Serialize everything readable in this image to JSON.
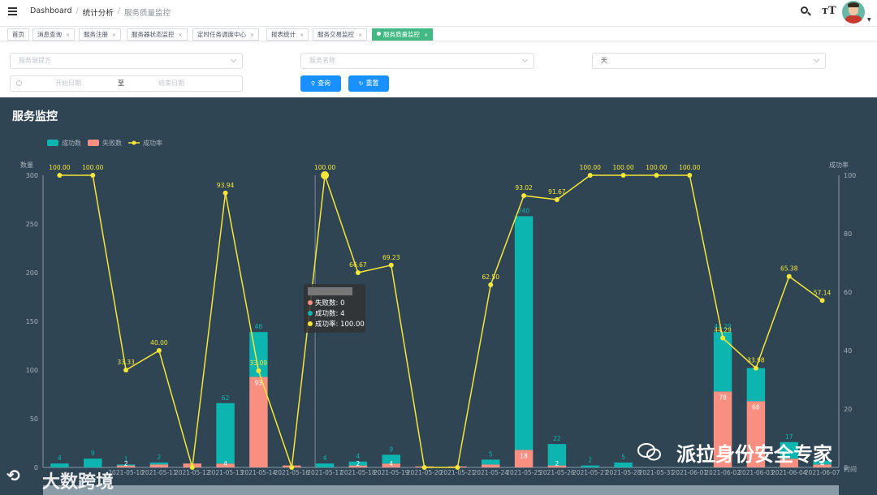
{
  "breadcrumb": [
    "Dashboard",
    "统计分析",
    "服务质量监控"
  ],
  "tabs": [
    {
      "label": "首页",
      "closable": false,
      "active": false
    },
    {
      "label": "消息查询",
      "closable": true,
      "active": false
    },
    {
      "label": "服务注册",
      "closable": true,
      "active": false
    },
    {
      "label": "服务器状态监控",
      "closable": true,
      "active": false
    },
    {
      "label": "定时任务调度中心",
      "closable": true,
      "active": false
    },
    {
      "label": "报表统计",
      "closable": true,
      "active": false
    },
    {
      "label": "服务交易监控",
      "closable": true,
      "active": false
    },
    {
      "label": "服务质量监控",
      "closable": true,
      "active": true
    }
  ],
  "filters": {
    "provider_placeholder": "服务端提方",
    "service_placeholder": "服务名称",
    "granularity_value": "天",
    "start_placeholder": "开始日期",
    "range_sep": "至",
    "end_placeholder": "结束日期",
    "query_label": "查询",
    "reset_label": "重置"
  },
  "panel": {
    "title": "服务监控"
  },
  "tooltip": {
    "failed": "失败数: 0",
    "success": "成功数: 4",
    "rate": "成功率: 100.00"
  },
  "watermarks": {
    "wechat": "派拉身份安全专家",
    "brand": "大数跨境"
  },
  "colors": {
    "panel_bg": "#2f4554",
    "success": "#0cb5b0",
    "failed": "#f88f80",
    "rate": "#f5e637"
  },
  "chart_data": {
    "type": "bar",
    "legend": [
      "成功数",
      "失败数",
      "成功率"
    ],
    "ylabel_left": "数量",
    "ylabel_right": "成功率",
    "xlabel": "时间",
    "ylim_left": [
      0,
      300
    ],
    "ylim_right": [
      0,
      100
    ],
    "yticks_left": [
      0,
      50,
      100,
      150,
      200,
      250,
      300
    ],
    "yticks_right": [
      0,
      20,
      40,
      60,
      80,
      100
    ],
    "categories": [
      "",
      "",
      "2021-05-10",
      "2021-05-11",
      "2021-05-12",
      "2021-05-13",
      "2021-05-14",
      "2021-05-16",
      "2021-05-17",
      "2021-05-18",
      "2021-05-19",
      "2021-05-20",
      "2021-05-21",
      "2021-05-24",
      "2021-05-25",
      "2021-05-26",
      "2021-05-27",
      "2021-05-28",
      "2021-05-31",
      "2021-06-01",
      "2021-06-02",
      "2021-06-03",
      "2021-06-04",
      "2021-06-07"
    ],
    "series": [
      {
        "name": "成功数",
        "values": [
          4,
          9,
          1,
          2,
          0,
          62,
          46,
          0,
          4,
          4,
          9,
          0,
          0,
          5,
          240,
          22,
          2,
          5,
          0,
          0,
          61,
          34,
          17,
          4
        ]
      },
      {
        "name": "失败数",
        "values": [
          0,
          0,
          2,
          3,
          4,
          4,
          93,
          2,
          0,
          2,
          4,
          1,
          1,
          3,
          18,
          2,
          0,
          0,
          0,
          0,
          78,
          68,
          9,
          3
        ]
      },
      {
        "name": "成功率",
        "values": [
          100.0,
          100.0,
          33.33,
          40.0,
          0,
          93.94,
          33.09,
          0,
          100.0,
          66.67,
          69.23,
          0,
          0,
          62.5,
          93.02,
          91.67,
          100.0,
          100.0,
          100.0,
          100.0,
          44.29,
          33.98,
          65.38,
          57.14
        ]
      }
    ],
    "bar_labels": [
      "4",
      "9",
      "1",
      "2",
      "",
      "62",
      "46",
      "",
      "4",
      "4",
      "9",
      "",
      "",
      "5",
      "240",
      "22",
      "2",
      "5",
      "",
      "",
      "44.29",
      "",
      "17",
      ""
    ],
    "failed_labels": [
      "",
      "",
      "2",
      "",
      "",
      "4",
      "93",
      "",
      "",
      "2",
      "4",
      "",
      "",
      "",
      "18",
      "2",
      "",
      "",
      "",
      "",
      "78",
      "68",
      "",
      "4"
    ],
    "rate_labels": [
      "100.00",
      "100.00",
      "33.33",
      "40.00",
      "",
      "93.94",
      "33.09",
      "",
      "100.00",
      "66.67",
      "69.23",
      "",
      "",
      "62.50",
      "93.02",
      "91.67",
      "100.00",
      "100.00",
      "100.00",
      "100.00",
      "44.29",
      "33.98",
      "65.38",
      "57.14"
    ]
  }
}
